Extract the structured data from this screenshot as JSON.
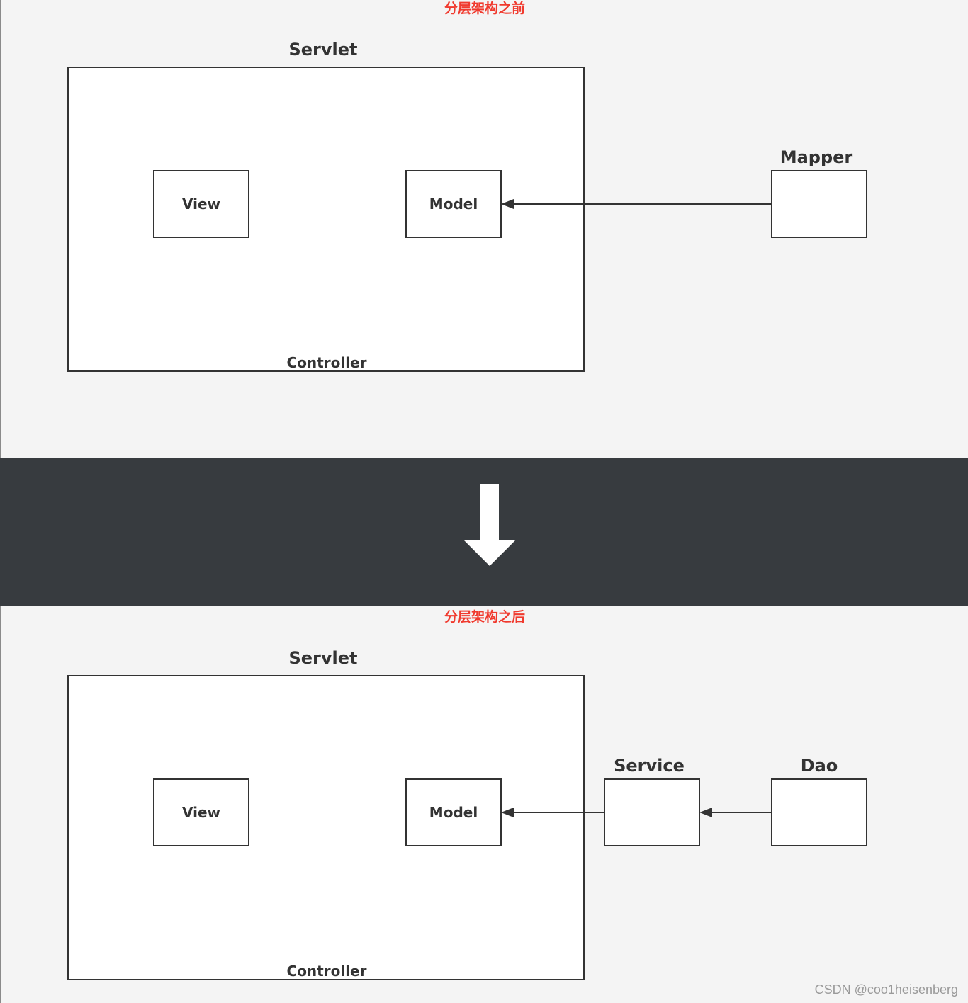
{
  "before": {
    "heading": "分层架构之前",
    "servlet_title": "Servlet",
    "controller_label": "Controller",
    "view_label": "View",
    "model_label": "Model",
    "mapper_title": "Mapper"
  },
  "transition_icon": "down-arrow-icon",
  "after": {
    "heading": "分层架构之后",
    "servlet_title": "Servlet",
    "controller_label": "Controller",
    "view_label": "View",
    "model_label": "Model",
    "service_title": "Service",
    "dao_title": "Dao"
  },
  "watermark": "CSDN @coo1heisenberg",
  "colors": {
    "heading_red": "#f03a2e",
    "band_dark": "#373b3f",
    "stroke": "#333333",
    "background": "#f4f4f4"
  }
}
